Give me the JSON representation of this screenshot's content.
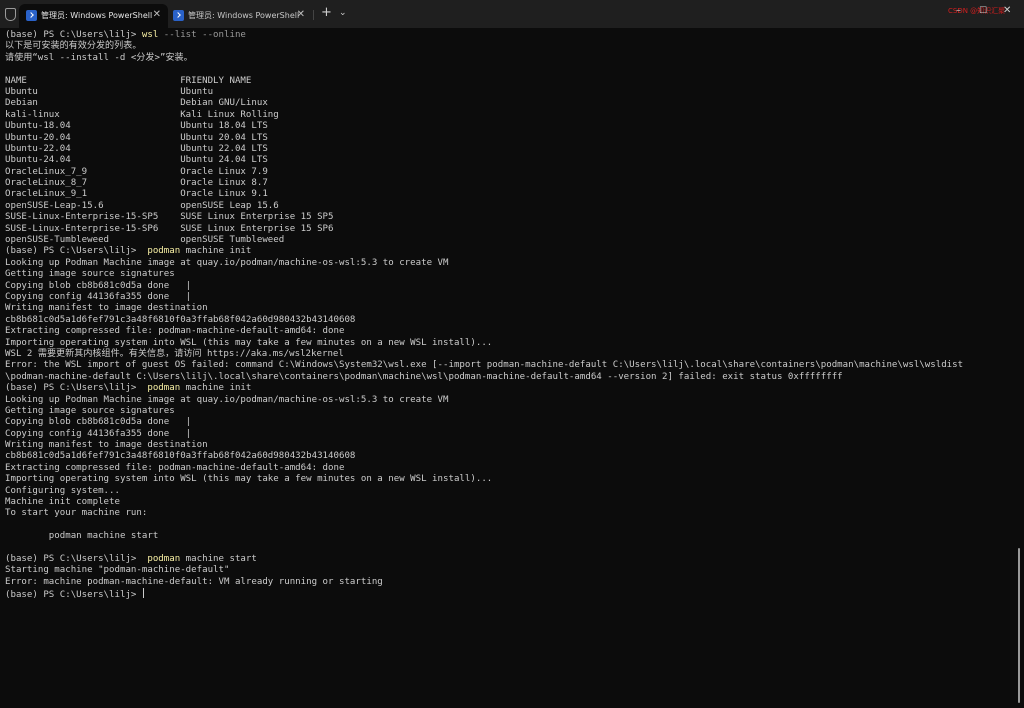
{
  "window": {
    "tabs": [
      {
        "label": "管理员: Windows PowerShell",
        "close": "✕"
      },
      {
        "label": "管理员: Windows PowerShell",
        "close": "✕"
      }
    ],
    "new_tab": "+",
    "dropdown": "⌄",
    "watermark": "CSDN @知识汇聚",
    "controls": {
      "minimize": "–",
      "maximize": "☐",
      "close": "✕"
    }
  },
  "terminal": {
    "prompt": "(base) PS C:\\Users\\lilj> ",
    "lines": [
      {
        "type": "prompt",
        "cmd": "wsl",
        "args": " --list --online"
      },
      {
        "text": "以下是可安装的有效分发的列表。"
      },
      {
        "text": "请使用“wsl --install -d <分发>”安装。"
      },
      {
        "text": ""
      },
      {
        "text": "NAME                            FRIENDLY NAME"
      },
      {
        "text": "Ubuntu                          Ubuntu"
      },
      {
        "text": "Debian                          Debian GNU/Linux"
      },
      {
        "text": "kali-linux                      Kali Linux Rolling"
      },
      {
        "text": "Ubuntu-18.04                    Ubuntu 18.04 LTS"
      },
      {
        "text": "Ubuntu-20.04                    Ubuntu 20.04 LTS"
      },
      {
        "text": "Ubuntu-22.04                    Ubuntu 22.04 LTS"
      },
      {
        "text": "Ubuntu-24.04                    Ubuntu 24.04 LTS"
      },
      {
        "text": "OracleLinux_7_9                 Oracle Linux 7.9"
      },
      {
        "text": "OracleLinux_8_7                 Oracle Linux 8.7"
      },
      {
        "text": "OracleLinux_9_1                 Oracle Linux 9.1"
      },
      {
        "text": "openSUSE-Leap-15.6              openSUSE Leap 15.6"
      },
      {
        "text": "SUSE-Linux-Enterprise-15-SP5    SUSE Linux Enterprise 15 SP5"
      },
      {
        "text": "SUSE-Linux-Enterprise-15-SP6    SUSE Linux Enterprise 15 SP6"
      },
      {
        "text": "openSUSE-Tumbleweed             openSUSE Tumbleweed"
      },
      {
        "type": "prompt",
        "cmd": " podman",
        "args": " machine init"
      },
      {
        "text": "Looking up Podman Machine image at quay.io/podman/machine-os-wsl:5.3 to create VM"
      },
      {
        "text": "Getting image source signatures"
      },
      {
        "text": "Copying blob cb8b681c0d5a done   |"
      },
      {
        "text": "Copying config 44136fa355 done   |"
      },
      {
        "text": "Writing manifest to image destination"
      },
      {
        "text": "cb8b681c0d5a1d6fef791c3a48f6810f0a3ffab68f042a60d980432b43140608"
      },
      {
        "text": "Extracting compressed file: podman-machine-default-amd64: done"
      },
      {
        "text": "Importing operating system into WSL (this may take a few minutes on a new WSL install)..."
      },
      {
        "text": "WSL 2 需要更新其内核组件。有关信息，请访问 https://aka.ms/wsl2kernel"
      },
      {
        "text": "Error: the WSL import of guest OS failed: command C:\\Windows\\System32\\wsl.exe [--import podman-machine-default C:\\Users\\lilj\\.local\\share\\containers\\podman\\machine\\wsl\\wsldist"
      },
      {
        "text": "\\podman-machine-default C:\\Users\\lilj\\.local\\share\\containers\\podman\\machine\\wsl\\podman-machine-default-amd64 --version 2] failed: exit status 0xffffffff"
      },
      {
        "type": "prompt",
        "cmd": " podman",
        "args": " machine init"
      },
      {
        "text": "Looking up Podman Machine image at quay.io/podman/machine-os-wsl:5.3 to create VM"
      },
      {
        "text": "Getting image source signatures"
      },
      {
        "text": "Copying blob cb8b681c0d5a done   |"
      },
      {
        "text": "Copying config 44136fa355 done   |"
      },
      {
        "text": "Writing manifest to image destination"
      },
      {
        "text": "cb8b681c0d5a1d6fef791c3a48f6810f0a3ffab68f042a60d980432b43140608"
      },
      {
        "text": "Extracting compressed file: podman-machine-default-amd64: done"
      },
      {
        "text": "Importing operating system into WSL (this may take a few minutes on a new WSL install)..."
      },
      {
        "text": "Configuring system..."
      },
      {
        "text": "Machine init complete"
      },
      {
        "text": "To start your machine run:"
      },
      {
        "text": ""
      },
      {
        "text": "        podman machine start"
      },
      {
        "text": ""
      },
      {
        "type": "prompt",
        "cmd": " podman",
        "args": " machine start"
      },
      {
        "text": "Starting machine \"podman-machine-default\""
      },
      {
        "text": "Error: machine podman-machine-default: VM already running or starting"
      },
      {
        "type": "prompt-cursor"
      }
    ]
  }
}
